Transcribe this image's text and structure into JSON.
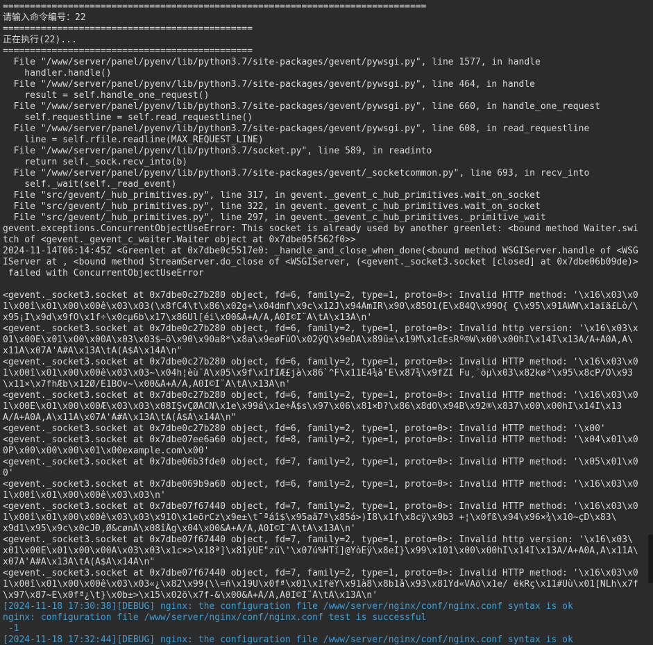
{
  "terminal": {
    "lines": [
      {
        "text": "==============================================================================",
        "kind": "normal"
      },
      {
        "text": "请输入命令编号：22",
        "kind": "normal"
      },
      {
        "text": "==============================================",
        "kind": "normal"
      },
      {
        "text": "正在执行(22)...",
        "kind": "normal"
      },
      {
        "text": "==============================================",
        "kind": "normal"
      },
      {
        "text": "  File \"/www/server/panel/pyenv/lib/python3.7/site-packages/gevent/pywsgi.py\", line 1577, in handle",
        "kind": "normal"
      },
      {
        "text": "    handler.handle()",
        "kind": "normal"
      },
      {
        "text": "  File \"/www/server/panel/pyenv/lib/python3.7/site-packages/gevent/pywsgi.py\", line 464, in handle",
        "kind": "normal"
      },
      {
        "text": "    result = self.handle_one_request()",
        "kind": "normal"
      },
      {
        "text": "  File \"/www/server/panel/pyenv/lib/python3.7/site-packages/gevent/pywsgi.py\", line 660, in handle_one_request",
        "kind": "normal"
      },
      {
        "text": "    self.requestline = self.read_requestline()",
        "kind": "normal"
      },
      {
        "text": "  File \"/www/server/panel/pyenv/lib/python3.7/site-packages/gevent/pywsgi.py\", line 608, in read_requestline",
        "kind": "normal"
      },
      {
        "text": "    line = self.rfile.readline(MAX_REQUEST_LINE)",
        "kind": "normal"
      },
      {
        "text": "  File \"/www/server/panel/pyenv/lib/python3.7/socket.py\", line 589, in readinto",
        "kind": "normal"
      },
      {
        "text": "    return self._sock.recv_into(b)",
        "kind": "normal"
      },
      {
        "text": "  File \"/www/server/panel/pyenv/lib/python3.7/site-packages/gevent/_socketcommon.py\", line 693, in recv_into",
        "kind": "normal"
      },
      {
        "text": "    self._wait(self._read_event)",
        "kind": "normal"
      },
      {
        "text": "  File \"src/gevent/_hub_primitives.py\", line 317, in gevent._gevent_c_hub_primitives.wait_on_socket",
        "kind": "normal"
      },
      {
        "text": "  File \"src/gevent/_hub_primitives.py\", line 322, in gevent._gevent_c_hub_primitives.wait_on_socket",
        "kind": "normal"
      },
      {
        "text": "  File \"src/gevent/_hub_primitives.py\", line 297, in gevent._gevent_c_hub_primitives._primitive_wait",
        "kind": "normal"
      },
      {
        "text": "gevent.exceptions.ConcurrentObjectUseError: This socket is already used by another greenlet: <bound method Waiter.swi",
        "kind": "normal"
      },
      {
        "text": "tch of <gevent._gevent_c_waiter.Waiter object at 0x7dbe05f562f0>>",
        "kind": "normal"
      },
      {
        "text": "2024-11-14T06:14:45Z <Greenlet at 0x7dbe0c5517e0: _handle_and_close_when_done(<bound method WSGIServer.handle of <WSG",
        "kind": "normal"
      },
      {
        "text": "IServer at , <bound method StreamServer.do_close of <WSGIServer, (<gevent._socket3.socket [closed] at 0x7dbe06b09de)>",
        "kind": "normal"
      },
      {
        "text": " failed with ConcurrentObjectUseError",
        "kind": "normal"
      },
      {
        "text": "",
        "kind": "normal"
      },
      {
        "text": "<gevent._socket3.socket at 0x7dbe0c27b280 object, fd=6, family=2, type=1, proto=0>: Invalid HTTP method: '\\x16\\x03\\x0",
        "kind": "normal"
      },
      {
        "text": "1\\x00î\\x01\\x00\\x00ê\\x03\\x03(\\x8fC4\\t\\x86\\x02g+\\x04dmf\\x9c\\x12J\\x94ÂmIR\\x90\\x85Õ1(E\\x84Q\\x99O{ Ç\\x95\\x91ÂWW\\x1aïä£Lò/\\",
        "kind": "normal"
      },
      {
        "text": "x95¡Î\\x9d\\x9fÖ\\x1f÷\\x0cµ6b\\x17\\x86Ül[éi\\x00&À+À/À,À0Ì©Ì¨À\\tÀ\\x13À\\n'",
        "kind": "normal"
      },
      {
        "text": "<gevent._socket3.socket at 0x7dbe0c27b280 object, fd=6, family=2, type=1, proto=0>: Invalid http version: '\\x16\\x03\\x",
        "kind": "normal"
      },
      {
        "text": "01\\x00È\\x01\\x00\\x00Ä\\x03\\x03$~õ\\x90\\x90a8*\\x8a\\x9eøFûÓ\\x02ÿQ\\x9eDÃ\\x89û±\\x19M\\x1cÊsRº®W\\x00\\x00hÌ\\x14Ì\\x13À/À+À0À,À\\",
        "kind": "normal"
      },
      {
        "text": "x11À\\x07À'À#À\\x13À\\tÀ(À$À\\x14À\\n\"",
        "kind": "normal"
      },
      {
        "text": "<gevent._socket3.socket at 0x7dbe0c27b280 object, fd=6, family=2, type=1, proto=0>: Invalid HTTP method: '\\x16\\x03\\x0",
        "kind": "normal"
      },
      {
        "text": "1\\x00î\\x01\\x00\\x00ê\\x03\\x03~\\x04h¦èù¯Â\\x05\\x9f\\x1fÌÆ£jà\\x86`^F\\x11È4¾à'É\\x87¾\\x9fZI Fu¸¯õµ\\x03\\x82kø²\\x95\\x8cP/Ö\\x93",
        "kind": "normal"
      },
      {
        "text": "\\x11×\\x7fhÆb\\x12Ø/Ê1BOv~\\x00&À+À/À,À0Ì©Ì¨À\\tÀ\\x13À\\n'",
        "kind": "normal"
      },
      {
        "text": "<gevent._socket3.socket at 0x7dbe0c27b280 object, fd=6, family=2, type=1, proto=0>: Invalid HTTP method: '\\x16\\x03\\x0",
        "kind": "normal"
      },
      {
        "text": "1\\x00Ê\\x01\\x00\\x00Æ\\x03\\x03\\x08ÏŞvÇØÁCN\\x1e\\x99á\\x1e÷Å$s\\x97\\x06\\x81×Ð?\\x86\\x8dÖ\\x94B\\x92®\\x837\\x00\\x00hÌ\\x14Ì\\x13",
        "kind": "normal"
      },
      {
        "text": "À/À+À0À,À\\x11À\\x07À'À#À\\x13À\\tÀ(À$À\\x14À\\n\"",
        "kind": "normal"
      },
      {
        "text": "<gevent._socket3.socket at 0x7dbe0c27b280 object, fd=6, family=2, type=1, proto=0>: Invalid HTTP method: '\\x00'",
        "kind": "normal"
      },
      {
        "text": "<gevent._socket3.socket at 0x7dbe07ee6a60 object, fd=8, family=2, type=1, proto=0>: Invalid HTTP method: '\\x04\\x01\\x0",
        "kind": "normal"
      },
      {
        "text": "0P\\x00\\x00\\x00\\x01\\x00example.com\\x00'",
        "kind": "normal"
      },
      {
        "text": "<gevent._socket3.socket at 0x7dbe06b3fde0 object, fd=7, family=2, type=1, proto=0>: Invalid HTTP method: '\\x05\\x01\\x0",
        "kind": "normal"
      },
      {
        "text": "0'",
        "kind": "normal"
      },
      {
        "text": "<gevent._socket3.socket at 0x7dbe069b9a60 object, fd=6, family=2, type=1, proto=0>: Invalid HTTP method: '\\x16\\x03\\x0",
        "kind": "normal"
      },
      {
        "text": "1\\x00î\\x01\\x00\\x00ê\\x03\\x03\\n'",
        "kind": "normal"
      },
      {
        "text": "<gevent._socket3.socket at 0x7dbe07f67440 object, fd=7, family=2, type=1, proto=0>: Invalid HTTP method: '\\x16\\x03\\x0",
        "kind": "normal"
      },
      {
        "text": "1\\x00î\\x01\\x00\\x00ê\\x03\\x03\\x91Ô\\x1eõrCz\\x9e±\\t¯ªáî$\\x95aå7ª\\x85á>)Ï8\\x1f\\x8cÿ\\x9b3 +¦\\x0fß\\x94\\x96×¾\\x10~çD\\x83\\",
        "kind": "normal"
      },
      {
        "text": "x9d1\\x95\\x9c\\x0cJÐ,Ø&cønÅ\\x08îÅg\\x04\\x00&À+À/À,À0Ì©Ì¨À\\tÀ\\x13À\\n'",
        "kind": "normal"
      },
      {
        "text": "<gevent._socket3.socket at 0x7dbe07f67440 object, fd=7, family=2, type=1, proto=0>: Invalid http version: '\\x16\\x03\\",
        "kind": "normal"
      },
      {
        "text": "x01\\x00È\\x01\\x00\\x00Ä\\x03\\x03\\x1c×>\\x18ª]\\x81ÿÜÊ\"zü\\'\\x07ú%HTï]@YòÈÿ\\x8eÏ}\\x99\\x101\\x00\\x00hÌ\\x14Ì\\x13À/À+À0À,À\\x11À\\",
        "kind": "normal"
      },
      {
        "text": "x07À'À#À\\x13À\\tÀ(À$À\\x14À\\n\"",
        "kind": "normal"
      },
      {
        "text": "<gevent._socket3.socket at 0x7dbe07f67440 object, fd=7, family=2, type=1, proto=0>: Invalid HTTP method: '\\x16\\x03\\x0",
        "kind": "normal"
      },
      {
        "text": "1\\x00î\\x01\\x00\\x00ê\\x03\\x03«¿\\x82\\x99(\\\\=ñ\\x19Ü\\x0fª\\x01\\x1fëY\\x91à8\\x8b1å\\x93\\x81Ýd«VÃõ\\x1e/ ëkRç\\x11#Ùù\\x01[NLh\\x7f",
        "kind": "normal"
      },
      {
        "text": "\\x97\\x87~È\\x0fª¿\\t}\\x0b±>\\x15\\x02õ\\x7f-&\\x00&À+À/À,À0Ì©Ì¨À\\tÀ\\x13À\\n'",
        "kind": "normal"
      },
      {
        "text": "[2024-11-18 17:30:38][DEBUG] nginx: the configuration file /www/server/nginx/conf/nginx.conf syntax is ok",
        "kind": "debug"
      },
      {
        "text": "nginx: configuration file /www/server/nginx/conf/nginx.conf test is successful",
        "kind": "success"
      },
      {
        "text": " -1",
        "kind": "success"
      },
      {
        "text": "[2024-11-18 17:32:44][DEBUG] nginx: the configuration file /www/server/nginx/conf/nginx.conf syntax is ok",
        "kind": "debug"
      }
    ],
    "colors": {
      "background": "#2b2b2b",
      "text": "#d8d8d8",
      "debug": "#3b9fd6"
    }
  }
}
